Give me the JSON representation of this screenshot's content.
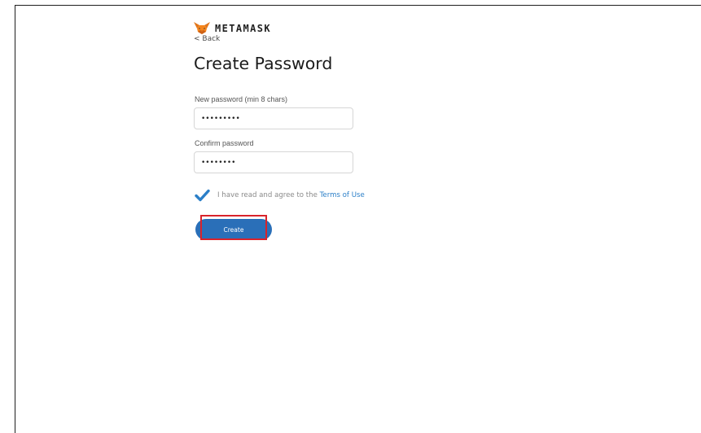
{
  "brand": {
    "name": "METAMASK"
  },
  "nav": {
    "back_label": "< Back"
  },
  "page": {
    "title": "Create Password"
  },
  "form": {
    "new_password": {
      "label": "New password (min 8 chars)",
      "value": "12345678a"
    },
    "confirm_password": {
      "label": "Confirm password",
      "value": "12345678"
    },
    "agree": {
      "checked": true,
      "text": "I have read and agree to the ",
      "link_text": "Terms of Use"
    },
    "create_label": "Create"
  },
  "colors": {
    "accent": "#2a6fb8",
    "link": "#2b7fc8",
    "checkbox": "#2b7fc8",
    "highlight": "#d9232b"
  }
}
